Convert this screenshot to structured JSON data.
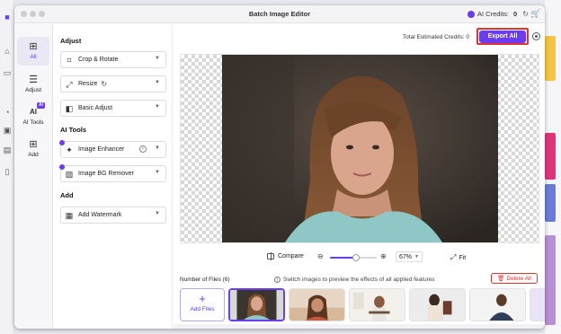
{
  "window": {
    "title": "Batch Image Editor",
    "credits_label": "AI Credits:",
    "credits_value": "0"
  },
  "rail": {
    "items": [
      {
        "label": "All",
        "icon": "grid-icon",
        "active": true
      },
      {
        "label": "Adjust",
        "icon": "sliders-icon"
      },
      {
        "label": "AI Tools",
        "icon": "ai-icon",
        "badge": "AI"
      },
      {
        "label": "Add",
        "icon": "plus-square-icon"
      }
    ]
  },
  "panel": {
    "adjust_heading": "Adjust",
    "crop_label": "Crop & Rotate",
    "resize_label": "Resize",
    "basic_label": "Basic Adjust",
    "ai_heading": "AI Tools",
    "enhancer_label": "Image Enhancer",
    "bg_remover_label": "Image BG Remover",
    "add_heading": "Add",
    "watermark_label": "Add Watermark"
  },
  "topbar": {
    "estimated_label": "Total Estimated Credits:",
    "estimated_value": "0",
    "export_label": "Export All"
  },
  "zoom": {
    "compare_label": "Compare",
    "zoom_level": "67%",
    "zoom_fraction": 0.55,
    "fit_label": "Fit"
  },
  "files": {
    "count_label": "Number of Files (6)",
    "hint": "Switch images to preview the effects of all applied features",
    "delete_label": "Delete All",
    "add_label": "Add Files",
    "selected_index": 0
  },
  "colors": {
    "accent": "#6b3cf2",
    "danger": "#e0332c"
  }
}
